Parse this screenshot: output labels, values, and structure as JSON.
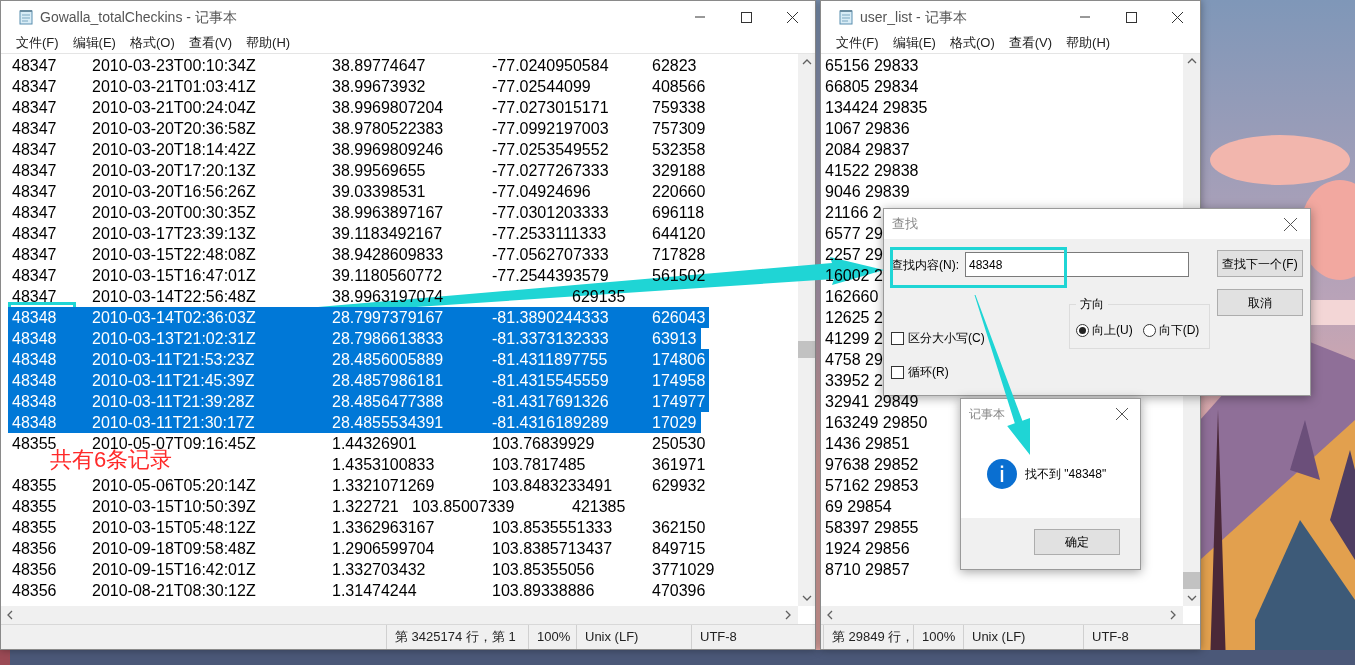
{
  "notepad_windows": [
    {
      "title": "Gowalla_totalCheckins - 记事本",
      "menu": [
        "文件(F)",
        "编辑(E)",
        "格式(O)",
        "查看(V)",
        "帮助(H)"
      ],
      "lines": [
        {
          "text": "48347\t2010-03-23T00:10:34Z\t38.89774647\t-77.0240950584\t62823",
          "selected": false
        },
        {
          "text": "48347\t2010-03-21T01:03:41Z\t38.99673932\t-77.02544099\t408566",
          "selected": false
        },
        {
          "text": "48347\t2010-03-21T00:24:04Z\t38.9969807204\t-77.0273015171\t759338",
          "selected": false
        },
        {
          "text": "48347\t2010-03-20T20:36:58Z\t38.9780522383\t-77.0992197003\t757309",
          "selected": false
        },
        {
          "text": "48347\t2010-03-20T18:14:42Z\t38.9969809246\t-77.0253549552\t532358",
          "selected": false
        },
        {
          "text": "48347\t2010-03-20T17:20:13Z\t38.99569655\t-77.0277267333\t329188",
          "selected": false
        },
        {
          "text": "48347\t2010-03-20T16:56:26Z\t39.03398531\t-77.04924696\t220660",
          "selected": false
        },
        {
          "text": "48347\t2010-03-20T00:30:35Z\t38.9963897167\t-77.0301203333\t696118",
          "selected": false
        },
        {
          "text": "48347\t2010-03-17T23:39:13Z\t39.1183492167\t-77.2533111333\t644120",
          "selected": false
        },
        {
          "text": "48347\t2010-03-15T22:48:08Z\t38.9428609833\t-77.0562707333\t717828",
          "selected": false
        },
        {
          "text": "48347\t2010-03-15T16:47:01Z\t39.1180560772\t-77.2544393579\t561502",
          "selected": false
        },
        {
          "text": "48347\t2010-03-14T22:56:48Z\t38.9963197074\t\t629135",
          "selected": false
        },
        {
          "text": "48348\t2010-03-14T02:36:03Z\t28.7997379167\t-81.3890244333\t626043",
          "selected": true
        },
        {
          "text": "48348\t2010-03-13T21:02:31Z\t28.7986613833\t-81.3373132333\t63913",
          "selected": true
        },
        {
          "text": "48348\t2010-03-11T21:53:23Z\t28.4856005889\t-81.4311897755\t174806",
          "selected": true
        },
        {
          "text": "48348\t2010-03-11T21:45:39Z\t28.4857986181\t-81.4315545559\t174958",
          "selected": true
        },
        {
          "text": "48348\t2010-03-11T21:39:28Z\t28.4856477388\t-81.4317691326\t174977",
          "selected": true
        },
        {
          "text": "48348\t2010-03-11T21:30:17Z\t28.4855534391\t-81.4316189289\t17029",
          "selected": true
        },
        {
          "text": "48355\t2010-05-07T09:16:45Z\t1.44326901\t103.76839929\t250530",
          "selected": false
        },
        {
          "text": "\t\t\t\t1.4353100833\t103.7817485\t361971",
          "selected": false
        },
        {
          "text": "48355\t2010-05-06T05:20:14Z\t1.3321071269\t103.8483233491\t629932",
          "selected": false
        },
        {
          "text": "48355\t2010-03-15T10:50:39Z\t1.322721\t103.85007339\t421385",
          "selected": false
        },
        {
          "text": "48355\t2010-03-15T05:48:12Z\t1.3362963167\t103.8535551333\t362150",
          "selected": false
        },
        {
          "text": "48356\t2010-09-18T09:58:48Z\t1.2906599704\t103.8385713437\t849715",
          "selected": false
        },
        {
          "text": "48356\t2010-09-15T16:42:01Z\t1.332703432\t103.85355056\t3771029",
          "selected": false
        },
        {
          "text": "48356\t2010-08-21T08:30:12Z\t1.31474244\t103.89338886\t470396",
          "selected": false
        }
      ],
      "status": [
        "第 3425174 行，第 1",
        "100%",
        "Unix (LF)",
        "UTF-8"
      ]
    },
    {
      "title": "user_list - 记事本",
      "menu": [
        "文件(F)",
        "编辑(E)",
        "格式(O)",
        "查看(V)",
        "帮助(H)"
      ],
      "lines": [
        {
          "text": "65156 29833",
          "selected": false
        },
        {
          "text": "66805 29834",
          "selected": false
        },
        {
          "text": "134424 29835",
          "selected": false
        },
        {
          "text": "1067 29836",
          "selected": false
        },
        {
          "text": "2084 29837",
          "selected": false
        },
        {
          "text": "41522 29838",
          "selected": false
        },
        {
          "text": "9046 29839",
          "selected": false
        },
        {
          "text": "21166 2",
          "selected": false
        },
        {
          "text": "6577 29",
          "selected": false
        },
        {
          "text": "2257 29",
          "selected": false
        },
        {
          "text": "16002 2",
          "selected": false
        },
        {
          "text": "162660",
          "selected": false
        },
        {
          "text": "12625 2",
          "selected": false
        },
        {
          "text": "41299 2",
          "selected": false
        },
        {
          "text": "4758 29",
          "selected": false
        },
        {
          "text": "33952 2",
          "selected": false
        },
        {
          "text": "32941 29849",
          "selected": false
        },
        {
          "text": "163249 29850",
          "selected": false
        },
        {
          "text": "1436 29851",
          "selected": false
        },
        {
          "text": "97638 29852",
          "selected": false
        },
        {
          "text": "57162 29853",
          "selected": false
        },
        {
          "text": "69 29854",
          "selected": false
        },
        {
          "text": "58397 29855",
          "selected": false
        },
        {
          "text": "1924 29856",
          "selected": false
        },
        {
          "text": "8710 29857",
          "selected": false
        }
      ],
      "status": [
        "第 29849 行，",
        "100%",
        "Unix (LF)",
        "UTF-8"
      ]
    }
  ],
  "find_dialog": {
    "title": "查找",
    "find_label": "查找内容(N):",
    "find_value": "48348",
    "buttons": [
      "查找下一个(F)",
      "取消"
    ],
    "options": [
      {
        "label": "区分大小写(C)",
        "checked": false
      },
      {
        "label": "循环(R)",
        "checked": false
      }
    ],
    "direction": {
      "label": "方向",
      "options": [
        {
          "label": "向上(U)",
          "selected": true
        },
        {
          "label": "向下(D)",
          "selected": false
        }
      ]
    }
  },
  "message_box": {
    "title": "记事本",
    "message": "找不到 \"48348\"",
    "button": "确定"
  },
  "annotation": {
    "text": "共有6条记录"
  }
}
